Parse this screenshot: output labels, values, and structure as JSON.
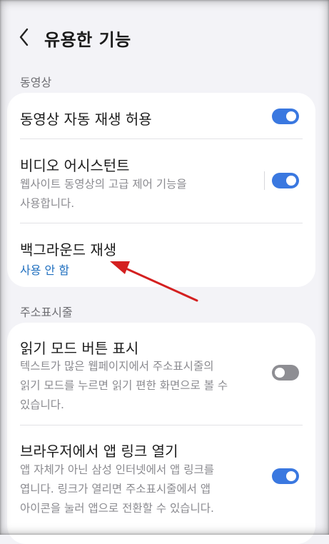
{
  "header": {
    "title": "유용한 기능",
    "back_icon": "chevron-left-icon"
  },
  "sections": {
    "video": {
      "label": "동영상",
      "autoplay": {
        "title": "동영상 자동 재생 허용",
        "enabled": true
      },
      "assistant": {
        "title": "비디오 어시스턴트",
        "desc_line1": "웹사이트 동영상의 고급 제어 기능을",
        "desc_line2": "사용합니다.",
        "enabled": true
      },
      "background": {
        "title": "백그라운드 재생",
        "status": "사용 안 함"
      }
    },
    "address_bar": {
      "label": "주소표시줄",
      "reader": {
        "title": "읽기 모드 버튼 표시",
        "desc_line1": "텍스트가 많은 웹페이지에서 주소표시줄의",
        "desc_line2": "읽기 모드를 누르면 읽기 편한 화면으로 볼 수",
        "desc_line3": "있습니다.",
        "enabled": false
      },
      "app_links": {
        "title": "브라우저에서 앱 링크 열기",
        "desc_line1": "앱 자체가 아닌 삼성 인터넷에서 앱 링크를",
        "desc_line2": "엽니다. 링크가 열리면 주소표시줄에서 앱",
        "desc_line3": "아이콘을 눌러 앱으로 전환할 수 있습니다.",
        "enabled": true
      }
    }
  },
  "colors": {
    "accent": "#3a78e0",
    "link": "#1f6fbf",
    "toggle_off": "#8e8e93",
    "annotation_arrow": "#d42020"
  }
}
